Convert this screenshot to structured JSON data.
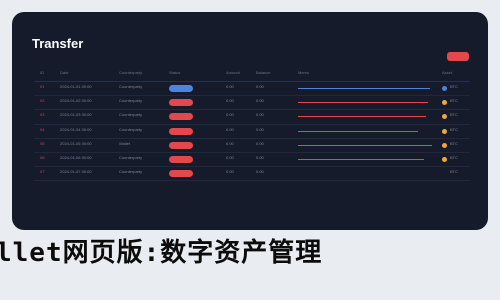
{
  "window": {
    "title": "Transfer"
  },
  "colors": {
    "accent": "#e2484e",
    "info": "#4d84e0",
    "warn": "#f3a63b",
    "panel": "#151b2b"
  },
  "table": {
    "headers": [
      "ID",
      "Date",
      "Counterparty",
      "Status",
      "Amount",
      "Balance",
      "Memo",
      "Asset"
    ],
    "rows": [
      {
        "id": "01",
        "date": "2024-01-01 00:00",
        "desc": "Counterparty",
        "a": "0.00",
        "b": "0.00",
        "line": "info",
        "tag": "BTC",
        "dot": "info"
      },
      {
        "id": "02",
        "date": "2024-01-02 00:00",
        "desc": "Counterparty",
        "a": "0.00",
        "b": "0.00",
        "line": "accent",
        "tag": "BTC",
        "dot": "warn"
      },
      {
        "id": "03",
        "date": "2024-01-03 00:00",
        "desc": "Counterparty",
        "a": "0.00",
        "b": "0.00",
        "line": "accent",
        "tag": "BTC",
        "dot": "warn"
      },
      {
        "id": "04",
        "date": "2024-01-04 00:00",
        "desc": "Counterparty",
        "a": "0.00",
        "b": "0.00",
        "line": "accent",
        "tag": "BTC",
        "dot": "warn"
      },
      {
        "id": "05",
        "date": "2024-01-05 00:00",
        "desc": "Wallet",
        "a": "0.00",
        "b": "0.00",
        "line": "accent",
        "tag": "BTC",
        "dot": "warn"
      },
      {
        "id": "06",
        "date": "2024-01-06 00:00",
        "desc": "Counterparty",
        "a": "0.00",
        "b": "0.00",
        "line": "accent",
        "tag": "BTC",
        "dot": "warn"
      },
      {
        "id": "07",
        "date": "2024-01-07 00:00",
        "desc": "Counterparty",
        "a": "0.00",
        "b": "0.00",
        "line": "none",
        "tag": "BTC",
        "dot": "none"
      }
    ]
  },
  "banner": {
    "text": "llet网页版:数字资产管理"
  }
}
